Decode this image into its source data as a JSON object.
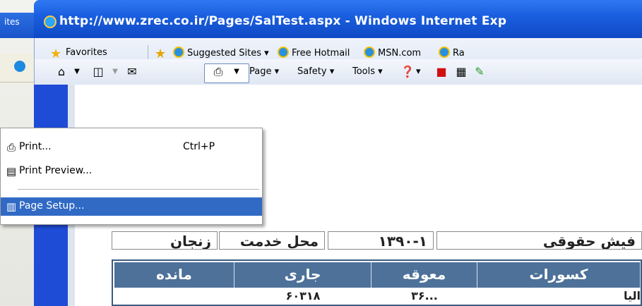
{
  "background_window": {
    "title_fragment": "ites"
  },
  "window": {
    "title": "http://www.zrec.co.ir/Pages/SalTest.aspx - Windows Internet Exp"
  },
  "favorites_bar": {
    "favorites_label": "Favorites",
    "links": [
      {
        "label": "Suggested Sites ▾",
        "icon": "ie-icon"
      },
      {
        "label": "Free Hotmail",
        "icon": "ie-icon"
      },
      {
        "label": "MSN.com",
        "icon": "ie-icon"
      },
      {
        "label": "Ra",
        "icon": "ie-icon"
      }
    ]
  },
  "command_bar": {
    "page_label": "Page ▾",
    "safety_label": "Safety ▾",
    "tools_label": "Tools ▾",
    "help_label": "▾"
  },
  "print_menu": {
    "items": [
      {
        "label": "Print...",
        "shortcut": "Ctrl+P",
        "icon": "printer-icon"
      },
      {
        "label": "Print Preview...",
        "shortcut": "",
        "icon": "print-preview-icon"
      },
      {
        "label": "Page Setup...",
        "shortcut": "",
        "icon": "page-setup-icon",
        "selected": true
      }
    ]
  },
  "page": {
    "info_row": {
      "payslip_label": "فیش حقوقی",
      "period_value": "۱۳۹۰-۱",
      "workplace_label": "محل خدمت",
      "workplace_value": "زنجان"
    },
    "table": {
      "headers": [
        "کسورات",
        "معوقه",
        "جاری",
        "مانده"
      ],
      "partial_row": [
        "الیا",
        "۳۶...",
        "۶۰۳۱۸",
        ""
      ]
    }
  },
  "colors": {
    "titlebar": "#1a5fe0",
    "menu_highlight": "#316ac5",
    "table_header": "#4d7199"
  }
}
